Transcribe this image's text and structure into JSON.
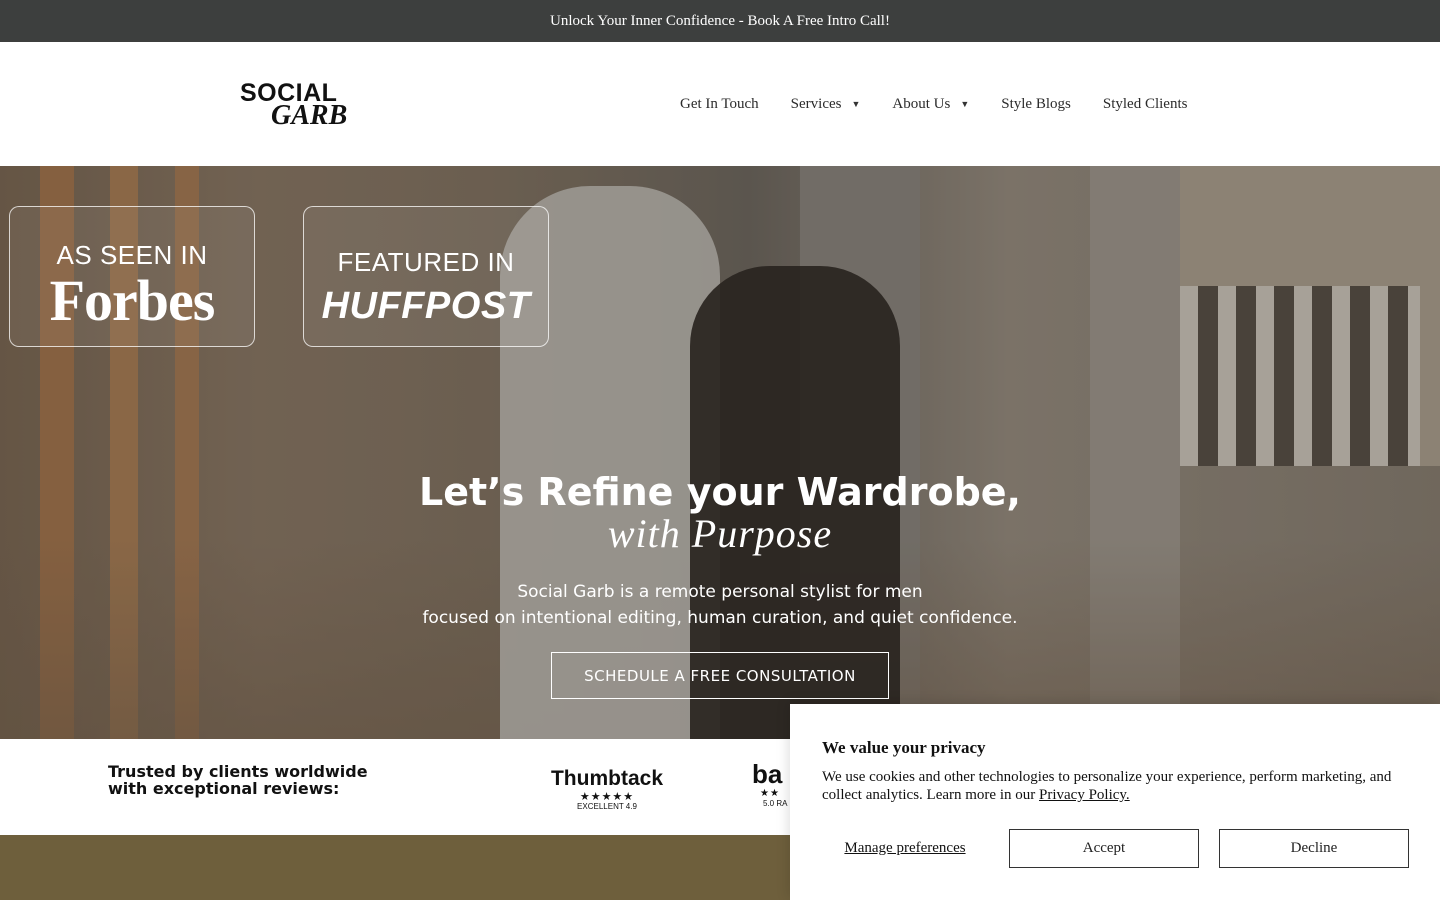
{
  "announcement": {
    "text": "Unlock Your Inner Confidence - Book A Free Intro Call!"
  },
  "header": {
    "logo_line1": "SOCIAL",
    "logo_line2": "GARB",
    "nav": {
      "get_in_touch": "Get In Touch",
      "services": "Services",
      "about_us": "About Us",
      "style_blogs": "Style Blogs",
      "styled_clients": "Styled Clients"
    },
    "dropdown_caret": "▼"
  },
  "hero": {
    "badges": {
      "forbes_caption": "AS SEEN IN",
      "forbes_brand": "Forbes",
      "huff_caption": "FEATURED IN",
      "huff_brand": "HUFFPOST"
    },
    "title_line1": "Let’s Refine your Wardrobe,",
    "title_line2": "with Purpose",
    "subtitle_line1": "Social Garb is a remote personal stylist for men",
    "subtitle_line2": "focused on intentional editing, human curation, and quiet confidence.",
    "cta_label": "SCHEDULE A FREE CONSULTATION"
  },
  "trusted": {
    "text": "Trusted by clients worldwide with exceptional reviews:",
    "thumbtack": {
      "name": "Thumbtack",
      "stars": "★★★★★",
      "rating": "EXCELLENT 4.9"
    },
    "bark": {
      "name": "ba",
      "stars": "★★",
      "rating": "5.0 RA"
    }
  },
  "cookie": {
    "title": "We value your privacy",
    "body": "We use cookies and other technologies to personalize your experience, perform marketing, and collect analytics. Learn more in our ",
    "link": "Privacy Policy.",
    "manage": "Manage preferences",
    "accept": "Accept",
    "decline": "Decline"
  },
  "colors": {
    "announcement_bg": "#3d3f3e",
    "olive_section": "#6e5f3c",
    "text_dark": "#111111"
  }
}
